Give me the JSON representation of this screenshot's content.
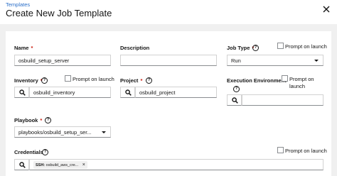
{
  "header": {
    "breadcrumb": "Templates",
    "title": "Create New Job Template"
  },
  "form": {
    "name": {
      "label": "Name",
      "required": "*",
      "value": "osbuild_setup_server"
    },
    "description": {
      "label": "Description",
      "value": ""
    },
    "job_type": {
      "label": "Job Type",
      "required": "*",
      "value": "Run",
      "prompt_label": "Prompt on launch"
    },
    "inventory": {
      "label": "Inventory",
      "required": "*",
      "value": "osbuild_inventory",
      "prompt_label": "Prompt on launch"
    },
    "project": {
      "label": "Project",
      "required": "*",
      "value": "osbuild_project"
    },
    "execution_environment": {
      "label": "Execution Environment",
      "value": "",
      "prompt_label": "Prompt on launch"
    },
    "playbook": {
      "label": "Playbook",
      "required": "*",
      "value": "playbooks/osbuild_setup_ser..."
    },
    "credentials": {
      "label": "Credentials",
      "prompt_label": "Prompt on launch",
      "chips": [
        {
          "type": "SSH:",
          "name": "osbuild_aws_cre...",
          "remove": "×"
        }
      ]
    }
  },
  "icons": {
    "help": "?",
    "search": "search-icon",
    "close": "close-icon"
  }
}
